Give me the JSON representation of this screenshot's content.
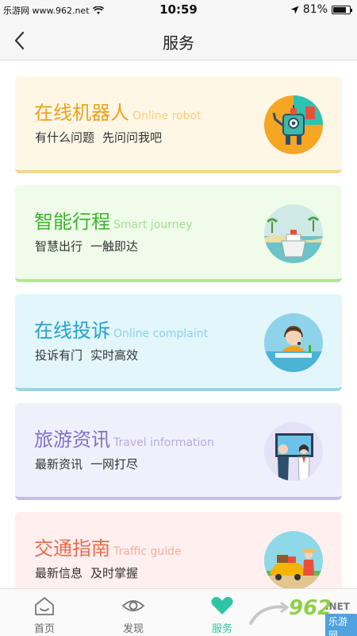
{
  "status": {
    "carrier": "乐游网 www.962.net",
    "time": "10:59",
    "battery": "81%",
    "battery_level": 0.81
  },
  "header": {
    "title": "服务"
  },
  "cards": [
    {
      "title": "在线机器人",
      "subtitle_en": "Online robot",
      "desc1": "有什么问题",
      "desc2": "先问问我吧",
      "bg": "#fff7e6",
      "title_color": "#f0a11c",
      "en_color": "#f7cf7e",
      "border": "#f5d58c"
    },
    {
      "title": "智能行程",
      "subtitle_en": "Smart journey",
      "desc1": "智慧出行",
      "desc2": "一触即达",
      "bg": "#effcea",
      "title_color": "#3db52f",
      "en_color": "#a3e08e",
      "border": "#b5e39c"
    },
    {
      "title": "在线投诉",
      "subtitle_en": "Online complaint",
      "desc1": "投诉有门",
      "desc2": "实时高效",
      "bg": "#e3f6fc",
      "title_color": "#1ea3cc",
      "en_color": "#89d2e8",
      "border": "#94d6e8"
    },
    {
      "title": "旅游资讯",
      "subtitle_en": "Travel information",
      "desc1": "最新资讯",
      "desc2": "一网打尽",
      "bg": "#f0f0fd",
      "title_color": "#8270c6",
      "en_color": "#b5abe0",
      "border": "#c5bde8"
    },
    {
      "title": "交通指南",
      "subtitle_en": "Traffic guide",
      "desc1": "最新信息",
      "desc2": "及时掌握",
      "bg": "#fff0ef",
      "title_color": "#ec6b4e",
      "en_color": "#f5ad9d",
      "border": "#f5b9ad"
    }
  ],
  "tabs": [
    {
      "label": "首页",
      "icon": "home-icon"
    },
    {
      "label": "发现",
      "icon": "eye-icon"
    },
    {
      "label": "服务",
      "icon": "heart-icon",
      "active": true
    }
  ],
  "watermark": {
    "number": "962",
    "net": ".NET",
    "cn": "乐游网"
  },
  "colors": {
    "accent": "#2fc4a6"
  }
}
